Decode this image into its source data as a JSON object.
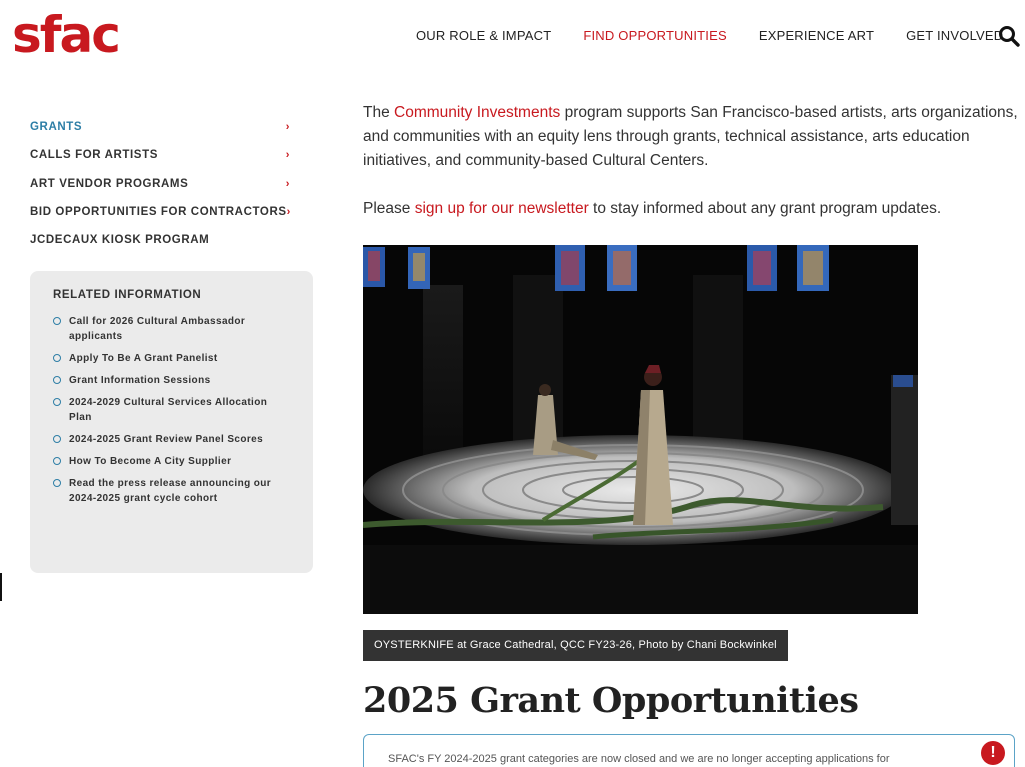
{
  "header": {
    "logo_text": "sfac",
    "nav": [
      {
        "label": "OUR ROLE & IMPACT"
      },
      {
        "label": "FIND OPPORTUNITIES"
      },
      {
        "label": "EXPERIENCE ART"
      },
      {
        "label": "GET INVOLVED"
      }
    ],
    "search_icon": "search-icon"
  },
  "sidebar": {
    "items": [
      {
        "label": "GRANTS"
      },
      {
        "label": "CALLS FOR ARTISTS"
      },
      {
        "label": "ART VENDOR PROGRAMS"
      },
      {
        "label": "BID OPPORTUNITIES FOR CONTRACTORS"
      },
      {
        "label": "JCDECAUX KIOSK PROGRAM"
      }
    ],
    "chevron": "›"
  },
  "related": {
    "title": "RELATED INFORMATION",
    "links": [
      {
        "label": "Call for 2026 Cultural Ambassador applicants"
      },
      {
        "label": "Apply To Be A Grant Panelist"
      },
      {
        "label": "Grant Information Sessions"
      },
      {
        "label": "2024-2029 Cultural Services Allocation Plan"
      },
      {
        "label": "2024-2025 Grant Review Panel Scores"
      },
      {
        "label": "How To Become A City Supplier"
      },
      {
        "label": "Read the press release announcing our 2024-2025 grant cycle cohort"
      }
    ]
  },
  "main": {
    "intro_pre": "The ",
    "intro_link": "Community Investments",
    "intro_post": " program supports San Francisco-based artists, arts organizations, and communities with an equity lens through grants, technical assistance, arts education initiatives, and community-based Cultural Centers.",
    "newsletter_pre": "Please ",
    "newsletter_link": "sign up for our newsletter",
    "newsletter_post": " to stay informed about any grant program updates.",
    "photo_caption": "OYSTERKNIFE at Grace Cathedral, QCC FY23-26, Photo by Chani Bockwinkel",
    "section_heading": "2025 Grant Opportunities",
    "notice_text": "SFAC's FY 2024-2025 grant categories are now closed and we are no longer accepting applications for",
    "alert_glyph": "!"
  },
  "colors": {
    "brand_red": "#c8191f",
    "accent_blue": "#2d7ea6"
  }
}
